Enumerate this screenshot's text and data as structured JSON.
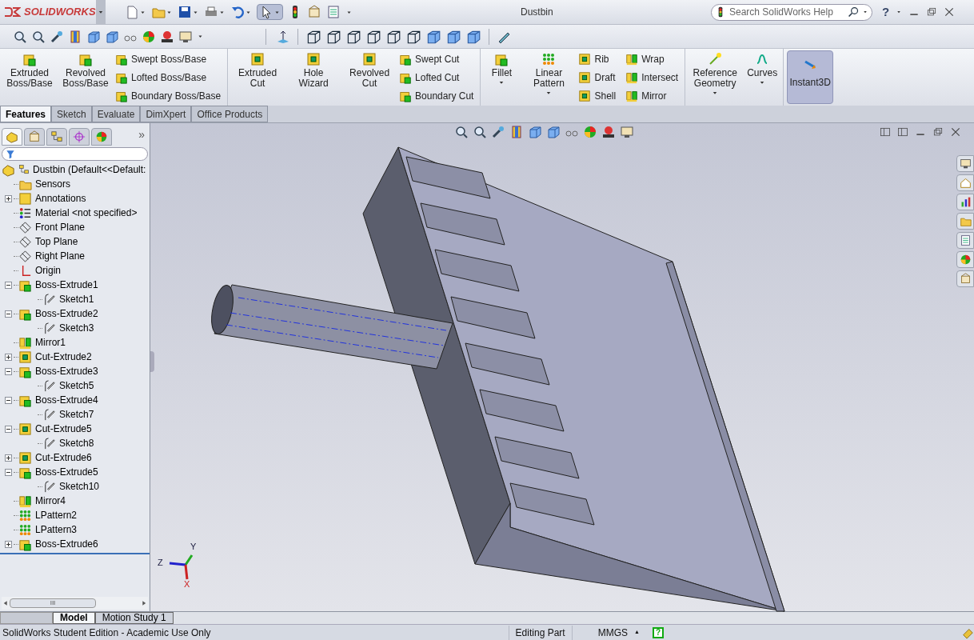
{
  "app": {
    "logo": "SOLIDWORKS",
    "title": "Dustbin",
    "search": {
      "placeholder": "Search SolidWorks Help"
    },
    "help": "?"
  },
  "ribbon": {
    "groups": [
      {
        "large": [
          {
            "label": "Extruded Boss/Base"
          },
          {
            "label": "Revolved Boss/Base"
          }
        ],
        "small": [
          "Swept Boss/Base",
          "Lofted Boss/Base",
          "Boundary Boss/Base"
        ]
      },
      {
        "large": [
          {
            "label": "Extruded Cut"
          },
          {
            "label": "Hole Wizard"
          },
          {
            "label": "Revolved Cut"
          }
        ],
        "small": [
          "Swept Cut",
          "Lofted Cut",
          "Boundary Cut"
        ]
      },
      {
        "large": [
          {
            "label": "Fillet",
            "menu": true
          },
          {
            "label": "Linear Pattern",
            "menu": true
          }
        ],
        "small": [
          "Rib",
          "Draft",
          "Shell"
        ]
      },
      {
        "small": [
          "Wrap",
          "Intersect",
          "Mirror"
        ]
      },
      {
        "large": [
          {
            "label": "Reference Geometry",
            "menu": true
          },
          {
            "label": "Curves",
            "menu": true
          }
        ]
      }
    ],
    "instant3d": {
      "label": "Instant3D",
      "on": true
    }
  },
  "tabs": [
    {
      "label": "Features",
      "selected": true
    },
    {
      "label": "Sketch",
      "selected": false
    },
    {
      "label": "Evaluate",
      "selected": false
    },
    {
      "label": "DimXpert",
      "selected": false
    },
    {
      "label": "Office Products",
      "selected": false
    }
  ],
  "panel_tabs": [
    {
      "selected": true
    },
    {
      "selected": false
    },
    {
      "selected": false
    },
    {
      "selected": false
    },
    {
      "selected": false
    }
  ],
  "tree": {
    "more": "»",
    "root": "Dustbin  (Default<<Default:",
    "items": [
      {
        "label": "Sensors",
        "kind": "folder"
      },
      {
        "label": "Annotations",
        "kind": "annotation",
        "expanded": false
      },
      {
        "label": "Material <not specified>",
        "kind": "material"
      },
      {
        "label": "Front Plane",
        "kind": "plane"
      },
      {
        "label": "Top Plane",
        "kind": "plane"
      },
      {
        "label": "Right Plane",
        "kind": "plane"
      },
      {
        "label": "Origin",
        "kind": "origin"
      },
      {
        "label": "Boss-Extrude1",
        "kind": "boss",
        "expanded": true,
        "children": [
          {
            "label": "Sketch1",
            "kind": "sketch"
          }
        ]
      },
      {
        "label": "Boss-Extrude2",
        "kind": "boss",
        "expanded": true,
        "children": [
          {
            "label": "Sketch3",
            "kind": "sketch"
          }
        ]
      },
      {
        "label": "Mirror1",
        "kind": "mirror"
      },
      {
        "label": "Cut-Extrude2",
        "kind": "cut",
        "expanded": false
      },
      {
        "label": "Boss-Extrude3",
        "kind": "boss",
        "expanded": true,
        "children": [
          {
            "label": "Sketch5",
            "kind": "sketch"
          }
        ]
      },
      {
        "label": "Boss-Extrude4",
        "kind": "boss",
        "expanded": true,
        "children": [
          {
            "label": "Sketch7",
            "kind": "sketch"
          }
        ]
      },
      {
        "label": "Cut-Extrude5",
        "kind": "cut",
        "expanded": true,
        "children": [
          {
            "label": "Sketch8",
            "kind": "sketch"
          }
        ]
      },
      {
        "label": "Cut-Extrude6",
        "kind": "cut",
        "expanded": false
      },
      {
        "label": "Boss-Extrude5",
        "kind": "boss",
        "expanded": true,
        "children": [
          {
            "label": "Sketch10",
            "kind": "sketch"
          }
        ]
      },
      {
        "label": "Mirror4",
        "kind": "mirror"
      },
      {
        "label": "LPattern2",
        "kind": "pattern"
      },
      {
        "label": "LPattern3",
        "kind": "pattern"
      },
      {
        "label": "Boss-Extrude6",
        "kind": "boss",
        "expanded": false
      }
    ],
    "scroll_grip": "III"
  },
  "triad": [
    "Z",
    "Y",
    "X"
  ],
  "bottom_tabs": [
    {
      "label": "Model",
      "selected": true
    },
    {
      "label": "Motion Study 1",
      "selected": false
    }
  ],
  "status": {
    "left": "SolidWorks Student Edition - Academic Use Only",
    "mode": "Editing Part",
    "units": "MMGS",
    "units_arrow": "▲",
    "help": "?"
  }
}
